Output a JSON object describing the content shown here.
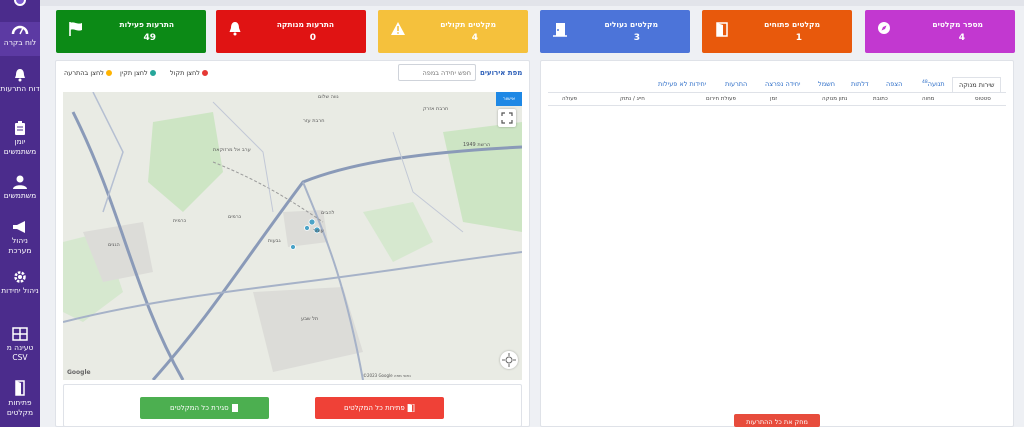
{
  "sidebar": {
    "items": [
      {
        "label": "לוח בקרה",
        "icon": "dashboard-gauge-icon"
      },
      {
        "label": "דוח התרעות",
        "icon": "bell-icon"
      },
      {
        "label": "יומן משתמשים",
        "icon": "clipboard-icon"
      },
      {
        "label": "משתמשים",
        "icon": "user-icon"
      },
      {
        "label": "ניהול מערכת",
        "icon": "megaphone-icon"
      },
      {
        "label": "ניהול יחידות",
        "icon": "cog-icon"
      },
      {
        "label": "טעינה מ CSV",
        "icon": "table-icon"
      },
      {
        "label": "פתיחות מקלטים",
        "icon": "door-icon"
      }
    ]
  },
  "cards": [
    {
      "title": "מספר מקלטים",
      "value": "4",
      "color": "#c238d0",
      "icon": "compass-icon"
    },
    {
      "title": "מקלטים פתוחים",
      "value": "1",
      "color": "#e8590c",
      "icon": "open-door-icon"
    },
    {
      "title": "מקלטים נעולים",
      "value": "3",
      "color": "#4c74d9",
      "icon": "closed-door-icon"
    },
    {
      "title": "מקלטים תקולים",
      "value": "4",
      "color": "#f5c13c",
      "icon": "warning-icon"
    },
    {
      "title": "התרעות מנותקה",
      "value": "0",
      "color": "#e01313",
      "icon": "bell-alert-icon"
    },
    {
      "title": "התרעות פעילות",
      "value": "49",
      "color": "#0c8a16",
      "icon": "flag-icon"
    }
  ],
  "map_panel": {
    "label": "מפת אירועים",
    "search_placeholder": "חפש יחידה במפה",
    "legend": [
      {
        "label": "לחצן תקול",
        "color": "#e53935"
      },
      {
        "label": "לחצן תקין",
        "color": "#26a69a"
      },
      {
        "label": "לחצן בהתרעה",
        "color": "#ffb300"
      }
    ],
    "map_button": "אישור",
    "labels": [
      {
        "text": "נווה שלום",
        "key": "l1"
      },
      {
        "text": "חרבת אזרק",
        "key": "l2"
      },
      {
        "text": "חרבת עזר",
        "key": "l3"
      },
      {
        "text": "ערב אל מרזוקאת",
        "key": "l4"
      },
      {
        "text": "כרמים",
        "key": "l5"
      },
      {
        "text": "כרמית",
        "key": "l6"
      },
      {
        "text": "להבים",
        "key": "l7"
      },
      {
        "text": "עומר",
        "key": "l8"
      },
      {
        "text": "תל שבע",
        "key": "l9"
      },
      {
        "text": "גבעות",
        "key": "l10"
      },
      {
        "text": "הגנים",
        "key": "l11"
      },
      {
        "text": "הרשת 1949",
        "key": "l12"
      }
    ],
    "footer": "נתוני מפה ‎©2023 Google",
    "google": "Google"
  },
  "actions": {
    "close_all": "סגירת כל המקלטים",
    "open_all": "פתיחת כל המקלטים"
  },
  "table_panel": {
    "tabs": [
      "שירות מנוקה",
      "תנועה",
      "הצפה",
      "דלתות",
      "חשמל",
      "יחידה נפרצה",
      "התרעות",
      "יחידות לא פעילות"
    ],
    "tab_badge": "48",
    "headers": [
      "סטטוס",
      "מחוה",
      "כתובת",
      "נתון מנוקה",
      "זמן",
      "פעולת חירום",
      "חייג / נתוק",
      "פעולה"
    ],
    "delete_all": "מחק את כל ההתרעות"
  }
}
